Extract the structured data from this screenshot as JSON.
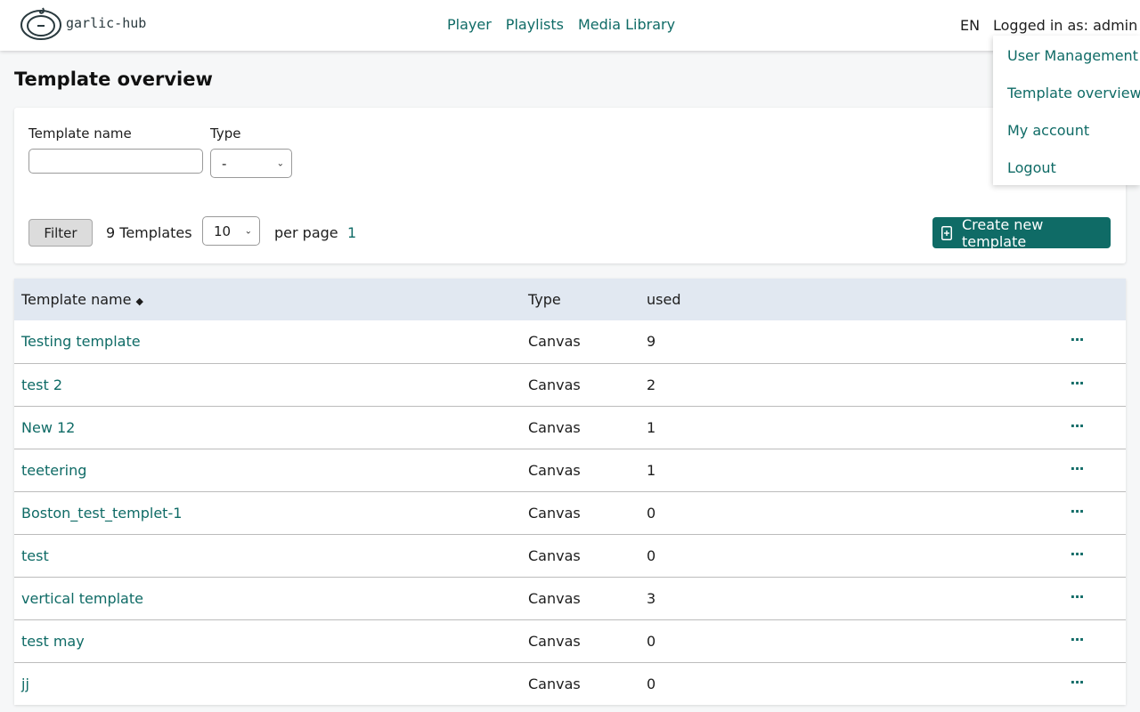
{
  "header": {
    "logo_text": "garlic-hub",
    "nav": [
      "Player",
      "Playlists",
      "Media Library"
    ],
    "language": "EN",
    "logged_in": "Logged in as: admin"
  },
  "user_menu": {
    "items": [
      "User Management",
      "Template overview",
      "My account",
      "Logout"
    ]
  },
  "page": {
    "title": "Template overview"
  },
  "filter": {
    "name_label": "Template name",
    "name_value": "",
    "type_label": "Type",
    "type_selected": "-",
    "filter_button": "Filter",
    "count_text": "9 Templates",
    "per_page_value": "10",
    "per_page_label": "per page",
    "current_page": "1",
    "create_button": "Create new template"
  },
  "table": {
    "columns": [
      "Template name",
      "Type",
      "used"
    ],
    "sort_indicator": "◆",
    "rows": [
      {
        "name": "Testing template",
        "type": "Canvas",
        "used": "9"
      },
      {
        "name": "test 2",
        "type": "Canvas",
        "used": "2"
      },
      {
        "name": "New 12",
        "type": "Canvas",
        "used": "1"
      },
      {
        "name": "teetering",
        "type": "Canvas",
        "used": "1"
      },
      {
        "name": "Boston_test_templet-1",
        "type": "Canvas",
        "used": "0"
      },
      {
        "name": "test",
        "type": "Canvas",
        "used": "0"
      },
      {
        "name": "vertical template",
        "type": "Canvas",
        "used": "3"
      },
      {
        "name": "test may",
        "type": "Canvas",
        "used": "0"
      },
      {
        "name": "jj",
        "type": "Canvas",
        "used": "0"
      }
    ],
    "row_action_icon": "more-icon"
  },
  "colors": {
    "accent": "#0f6b66",
    "table_header_bg": "#e1e8f1",
    "page_bg": "#f6f7f8"
  }
}
